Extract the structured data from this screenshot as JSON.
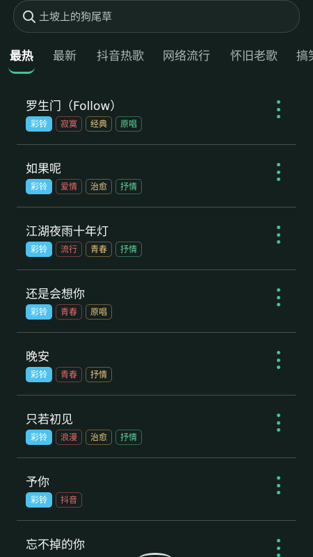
{
  "search": {
    "placeholder": "土坡上的狗尾草"
  },
  "tabs": [
    {
      "label": "最热",
      "active": true
    },
    {
      "label": "最新"
    },
    {
      "label": "抖音热歌"
    },
    {
      "label": "网络流行"
    },
    {
      "label": "怀旧老歌"
    },
    {
      "label": "搞笑"
    }
  ],
  "songs": [
    {
      "title": "罗生门（Follow）",
      "tags": [
        {
          "text": "彩铃",
          "color": "blue"
        },
        {
          "text": "寂寞",
          "color": "red"
        },
        {
          "text": "经典",
          "color": "yellow"
        },
        {
          "text": "原唱",
          "color": "green"
        }
      ]
    },
    {
      "title": "如果呢",
      "tags": [
        {
          "text": "彩铃",
          "color": "blue"
        },
        {
          "text": "爱情",
          "color": "red"
        },
        {
          "text": "治愈",
          "color": "yellow"
        },
        {
          "text": "抒情",
          "color": "green"
        }
      ]
    },
    {
      "title": "江湖夜雨十年灯",
      "tags": [
        {
          "text": "彩铃",
          "color": "blue"
        },
        {
          "text": "流行",
          "color": "red"
        },
        {
          "text": "青春",
          "color": "yellow"
        },
        {
          "text": "抒情",
          "color": "green"
        }
      ]
    },
    {
      "title": "还是会想你",
      "tags": [
        {
          "text": "彩铃",
          "color": "blue"
        },
        {
          "text": "青春",
          "color": "red"
        },
        {
          "text": "原唱",
          "color": "yellow"
        }
      ]
    },
    {
      "title": "晚安",
      "tags": [
        {
          "text": "彩铃",
          "color": "blue"
        },
        {
          "text": "青春",
          "color": "red"
        },
        {
          "text": "抒情",
          "color": "yellow"
        }
      ]
    },
    {
      "title": "只若初见",
      "tags": [
        {
          "text": "彩铃",
          "color": "blue"
        },
        {
          "text": "浪漫",
          "color": "red"
        },
        {
          "text": "治愈",
          "color": "yellow"
        },
        {
          "text": "抒情",
          "color": "green"
        }
      ]
    },
    {
      "title": "予你",
      "tags": [
        {
          "text": "彩铃",
          "color": "blue"
        },
        {
          "text": "抖音",
          "color": "red"
        }
      ]
    },
    {
      "title": "忘不掉的你",
      "tags": []
    }
  ],
  "icons": {
    "search": "search-icon",
    "more": "more-vertical-icon"
  },
  "colors": {
    "accent": "#3fc4a0",
    "background": "#14201e",
    "tag_blue": "#4ec1ee"
  }
}
